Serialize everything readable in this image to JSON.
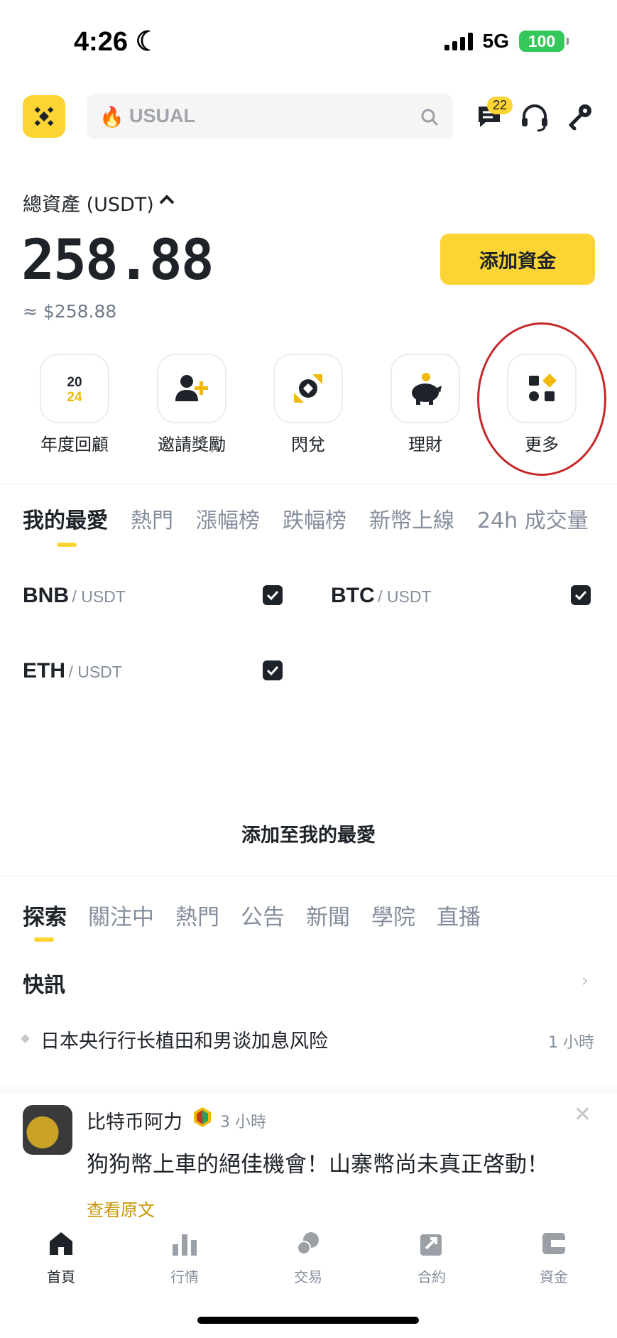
{
  "status": {
    "time": "4:26",
    "network": "5G",
    "battery": "100"
  },
  "header": {
    "search_placeholder": "USUAL",
    "messages_badge": "22"
  },
  "balance": {
    "label": "總資產 (USDT)",
    "value": "258.88",
    "fiat": "≈ $258.88",
    "add_funds": "添加資金"
  },
  "quick_actions": [
    {
      "label": "年度回顧",
      "icon": "2024-recap-icon"
    },
    {
      "label": "邀請獎勵",
      "icon": "invite-user-icon"
    },
    {
      "label": "閃兌",
      "icon": "convert-icon"
    },
    {
      "label": "理財",
      "icon": "piggy-bank-icon"
    },
    {
      "label": "更多",
      "icon": "more-grid-icon"
    }
  ],
  "market_tabs": [
    "我的最愛",
    "熱門",
    "漲幅榜",
    "跌幅榜",
    "新幣上線",
    "24h 成交量"
  ],
  "favorites": [
    {
      "base": "BNB",
      "quote": "/ USDT",
      "checked": true
    },
    {
      "base": "BTC",
      "quote": "/ USDT",
      "checked": true
    },
    {
      "base": "ETH",
      "quote": "/ USDT",
      "checked": true
    }
  ],
  "add_favorites": "添加至我的最愛",
  "feed_tabs": [
    "探索",
    "關注中",
    "熱門",
    "公告",
    "新聞",
    "學院",
    "直播"
  ],
  "flash": {
    "title": "快訊",
    "items": [
      {
        "text": "日本央行行长植田和男谈加息风险",
        "time": "1 小時"
      }
    ]
  },
  "post": {
    "author": "比特币阿力",
    "time": "3 小時",
    "text": "狗狗幣上車的絕佳機會！山寨幣尚未真正啓動！",
    "link": "查看原文"
  },
  "bottom_nav": [
    "首頁",
    "行情",
    "交易",
    "合約",
    "資金"
  ],
  "colors": {
    "accent": "#fcd535",
    "text": "#1e2329",
    "muted": "#848e9c",
    "annotation": "#c62828"
  }
}
